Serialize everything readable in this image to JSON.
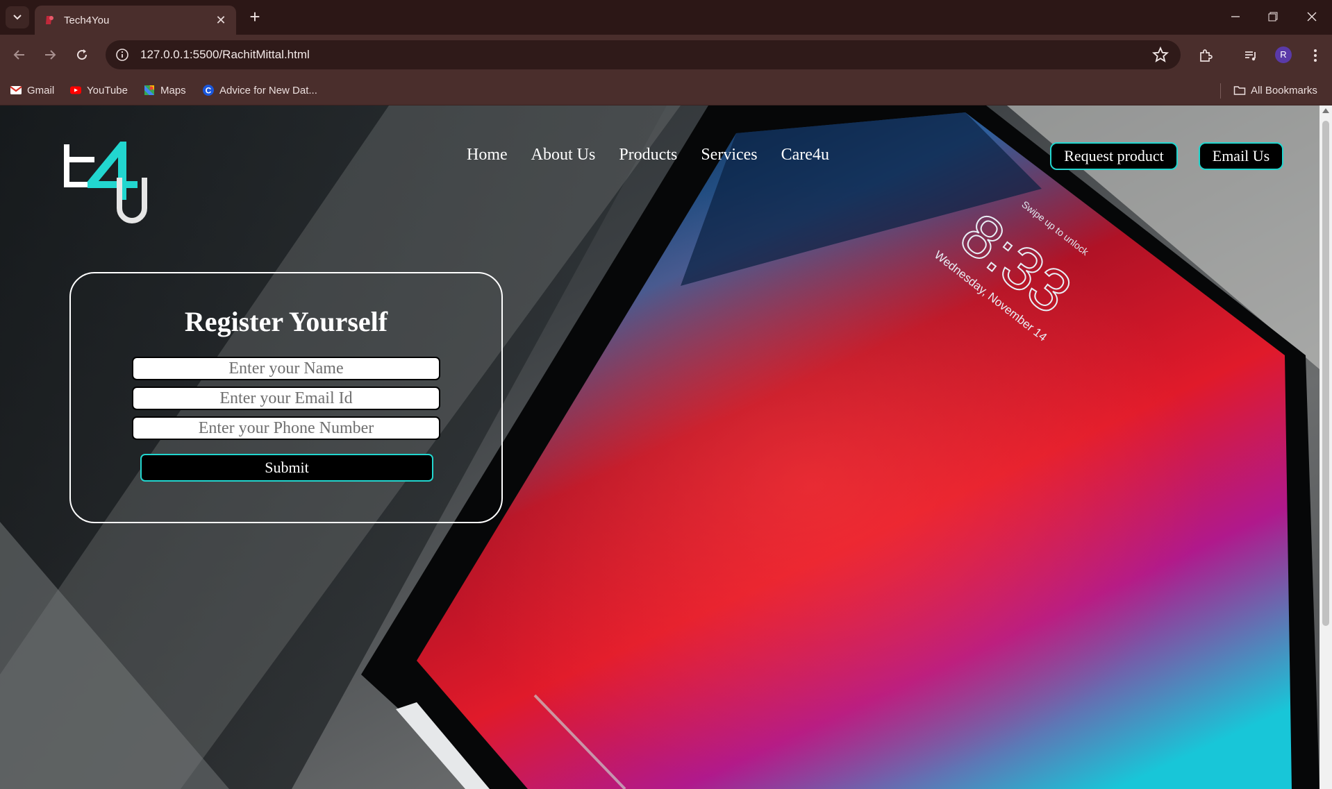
{
  "browser": {
    "tab_title": "Tech4You",
    "url": "127.0.0.1:5500/RachitMittal.html",
    "profile_initial": "R",
    "bookmarks": [
      {
        "label": "Gmail",
        "icon": "gmail-icon"
      },
      {
        "label": "YouTube",
        "icon": "youtube-icon"
      },
      {
        "label": "Maps",
        "icon": "maps-icon"
      },
      {
        "label": "Advice for New Dat...",
        "icon": "c-site-icon"
      }
    ],
    "all_bookmarks": "All Bookmarks"
  },
  "site": {
    "logo_text": "t4U",
    "nav": [
      "Home",
      "About Us",
      "Products",
      "Services",
      "Care4u"
    ],
    "request_button": "Request product",
    "email_button": "Email Us",
    "form": {
      "title": "Register Yourself",
      "name_placeholder": "Enter your Name",
      "email_placeholder": "Enter your Email Id",
      "phone_placeholder": "Enter your Phone Number",
      "submit_label": "Submit"
    },
    "hero_device": {
      "lock_hint": "Swipe up to unlock",
      "time": "8:33",
      "date": "Wednesday, November 14"
    }
  },
  "colors": {
    "accent": "#22d6cf",
    "chrome_dark": "#2c1716",
    "chrome": "#4a2e2c"
  }
}
